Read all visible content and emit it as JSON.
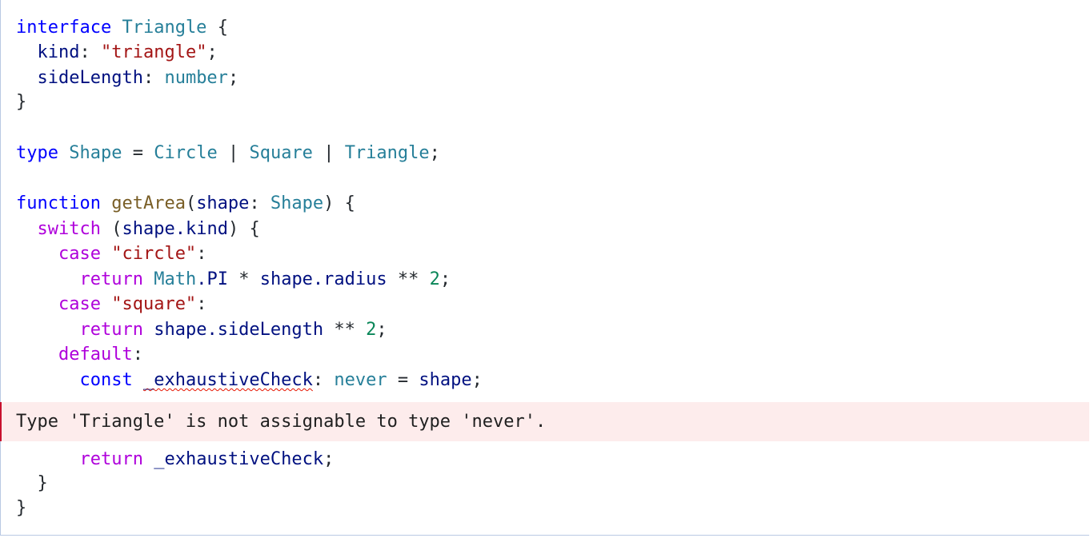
{
  "code": {
    "interface_kw": "interface",
    "triangle_name": "Triangle",
    "open_brace": "{",
    "kind_prop": "kind",
    "colon": ":",
    "triangle_str": "\"triangle\"",
    "semicolon": ";",
    "sidelength_prop": "sideLength",
    "number_type": "number",
    "close_brace": "}",
    "type_kw": "type",
    "shape_name": "Shape",
    "equals": "=",
    "circle_name": "Circle",
    "pipe": "|",
    "square_name": "Square",
    "function_kw": "function",
    "getarea_name": "getArea",
    "open_paren": "(",
    "shape_param": "shape",
    "close_paren": ")",
    "switch_kw": "switch",
    "shape_kind": "shape.kind",
    "case_kw": "case",
    "circle_str": "\"circle\"",
    "return_kw": "return",
    "math_obj": "Math",
    "pi_member": ".PI",
    "times": "*",
    "shape_radius": "shape.radius",
    "power": "**",
    "two": "2",
    "square_str": "\"square\"",
    "shape_sidelength": "shape.sideLength",
    "default_kw": "default",
    "const_kw": "const",
    "exhaustive_var": "_exhaustiveCheck",
    "never_type": "never",
    "shape_value": "shape"
  },
  "error": {
    "message": "Type 'Triangle' is not assignable to type 'never'."
  },
  "colors": {
    "keyword": "#0000ff",
    "control": "#af00db",
    "type": "#267f99",
    "string": "#a31515",
    "number": "#098658",
    "function": "#795e26",
    "variable": "#001080",
    "error_background": "#fdecec",
    "error_border": "#c8102e"
  }
}
